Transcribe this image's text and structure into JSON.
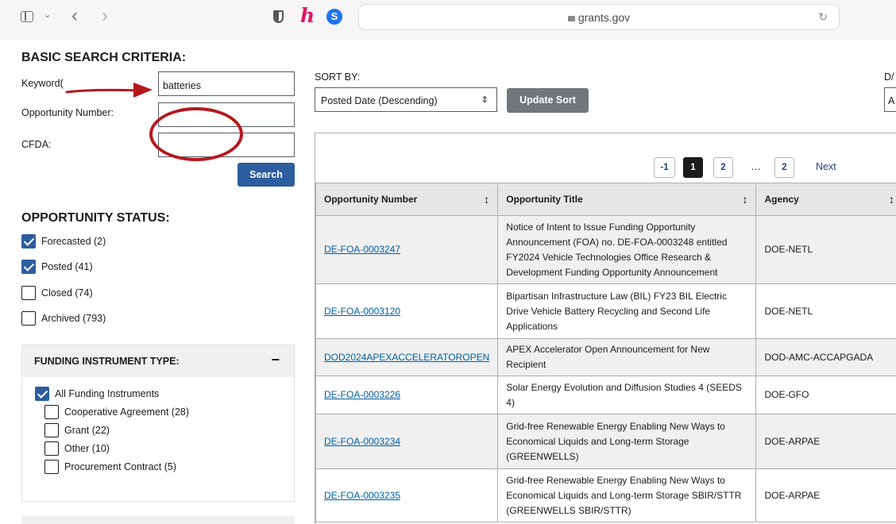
{
  "browser": {
    "url": "grants.gov"
  },
  "search": {
    "heading": "BASIC SEARCH CRITERIA:",
    "keyword_label": "Keyword(",
    "keyword_value": "batteries",
    "opp_number_label": "Opportunity Number:",
    "cfda_label": "CFDA:",
    "search_button": "Search"
  },
  "status": {
    "heading": "OPPORTUNITY STATUS:",
    "items": [
      {
        "label": "Forecasted (2)",
        "checked": true
      },
      {
        "label": "Posted (41)",
        "checked": true
      },
      {
        "label": "Closed (74)",
        "checked": false
      },
      {
        "label": "Archived (793)",
        "checked": false
      }
    ]
  },
  "funding": {
    "heading": "FUNDING INSTRUMENT TYPE:",
    "collapse_symbol": "−",
    "items": [
      {
        "label": "All Funding Instruments",
        "checked": true
      },
      {
        "label": "Cooperative Agreement (28)",
        "checked": false
      },
      {
        "label": "Grant (22)",
        "checked": false
      },
      {
        "label": "Other (10)",
        "checked": false
      },
      {
        "label": "Procurement Contract (5)",
        "checked": false
      }
    ]
  },
  "sort": {
    "label": "SORT BY:",
    "value": "Posted Date (Descending)",
    "button": "Update Sort",
    "cut_label": "D/",
    "cut_field": "A"
  },
  "pagination": {
    "prev": "-1",
    "current": "1",
    "next_page": "2",
    "ellipsis": "…",
    "last": "2",
    "next": "Next"
  },
  "table": {
    "headers": [
      "Opportunity Number",
      "Opportunity Title",
      "Agency"
    ],
    "sort_icon": "↕",
    "rows": [
      {
        "number": "DE-FOA-0003247",
        "title": "Notice of Intent to Issue Funding Opportunity Announcement (FOA) no. DE-FOA-0003248 entitled FY2024 Vehicle Technologies Office Research & Development Funding Opportunity Announcement",
        "agency": "DOE-NETL"
      },
      {
        "number": "DE-FOA-0003120",
        "title": "Bipartisan Infrastructure Law (BIL) FY23 BIL Electric Drive Vehicle Battery Recycling and Second Life Applications",
        "agency": "DOE-NETL"
      },
      {
        "number": "DOD2024APEXACCELERATOROPEN",
        "title": "APEX Accelerator Open Announcement for New Recipient",
        "agency": "DOD-AMC-ACCAPGADA"
      },
      {
        "number": "DE-FOA-0003226",
        "title": "Solar Energy Evolution and Diffusion Studies 4 (SEEDS 4)",
        "agency": "DOE-GFO"
      },
      {
        "number": "DE-FOA-0003234",
        "title": "Grid-free Renewable Energy Enabling New Ways to Economical Liquids and Long-term Storage (GREENWELLS)",
        "agency": "DOE-ARPAE"
      },
      {
        "number": "DE-FOA-0003235",
        "title": "Grid-free Renewable Energy Enabling New Ways to Economical Liquids and Long-term Storage SBIR/STTR (GREENWELLS SBIR/STTR)",
        "agency": "DOE-ARPAE"
      }
    ]
  },
  "colors": {
    "accent": "#2c5d9f",
    "annotation": "#b3191d",
    "link": "#005ea2"
  }
}
